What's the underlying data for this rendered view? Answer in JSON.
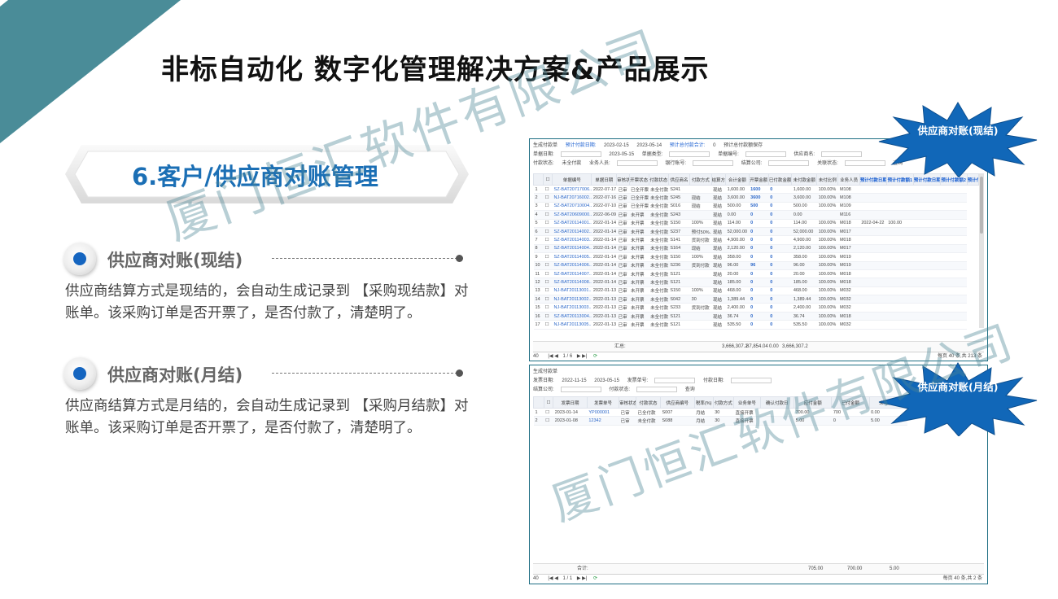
{
  "title": "非标自动化 数字化管理解决方案&产品展示",
  "section": "6.客户/供应商对账管理",
  "bullets": [
    {
      "heading": "供应商对账(现结)",
      "text": "供应商结算方式是现结的，会自动生成记录到 【采购现结款】对账单。该采购订单是否开票了，是否付款了，清楚明了。"
    },
    {
      "heading": "供应商对账(月结)",
      "text": "供应商结算方式是月结的，会自动生成记录到 【采购月结款】对账单。该采购订单是否开票了，是否付款了，清楚明了。"
    }
  ],
  "watermark": "厦门恒汇软件有限公司",
  "colors": {
    "teal": "#4a8c98",
    "title_blue": "#1b6fb5",
    "burst_blue": "#1167b8"
  },
  "bursts": {
    "top": "供应商对账(现结)",
    "bottom": "供应商对账(月结)"
  },
  "cash_panel": {
    "filters": {
      "btn_generate": "生成付款单",
      "plan_date_label": "预计付款日期:",
      "plan_date_from": "2023-02-15",
      "plan_date_to": "2023-05-14",
      "total_label": "预计总付款合计:",
      "total_value": "0",
      "save_plan": "预计总付款额保存",
      "order_date_label": "单据日期:",
      "order_date_to": "2023-05-15",
      "order_type_label": "单据类型:",
      "order_no_label": "单据编号:",
      "supplier_label": "供应商名:",
      "pay_status_label": "付款状态:",
      "pay_status_value": "未全付款",
      "salesman_label": "业务人员:",
      "bank_label": "银行账号:",
      "company_label": "结算公司:",
      "related_label": "关联状态:",
      "search": "查询"
    },
    "columns": [
      "单据编号",
      "单据日期",
      "审核状态",
      "开票状态",
      "付款状态",
      "供应商名",
      "付款方式",
      "结算方式",
      "合计金额",
      "开票金额",
      "已付款金额",
      "未付款金额",
      "未付比例",
      "业务人员",
      "预计付款日期1",
      "预计付款额1",
      "预计付款日期2",
      "预计付款额2",
      "预计付款日期"
    ],
    "rows": [
      [
        "1",
        "SZ-BAT20717006...",
        "2022-07-17",
        "已审",
        "已全开票",
        "未全付款",
        "S241",
        "",
        "现结",
        "1,600.00",
        "1600",
        "0",
        "1,600.00",
        "100.00%",
        "M108",
        "",
        "",
        "",
        ""
      ],
      [
        "2",
        "NJ-BAT20716002...",
        "2022-07-16",
        "已审",
        "已全开票",
        "未全付款",
        "S245",
        "现结",
        "现结",
        "3,600.00",
        "3600",
        "0",
        "3,600.00",
        "100.00%",
        "M108",
        "",
        "",
        "",
        ""
      ],
      [
        "3",
        "SZ-BAT20710004...",
        "2022-07-10",
        "已审",
        "已全开票",
        "未全付款",
        "S016",
        "现结",
        "现结",
        "500.00",
        "500",
        "0",
        "500.00",
        "100.00%",
        "M109",
        "",
        "",
        "",
        ""
      ],
      [
        "4",
        "SZ-BAT20609000...",
        "2022-06-09",
        "已审",
        "未开票",
        "未全付款",
        "S243",
        "",
        "现结",
        "0.00",
        "0",
        "0",
        "0.00",
        "",
        "M116",
        "",
        "",
        "",
        ""
      ],
      [
        "5",
        "SZ-BAT20114001...",
        "2022-01-14",
        "已审",
        "未开票",
        "未全付款",
        "S150",
        "100%",
        "现结",
        "114.00",
        "0",
        "0",
        "114.00",
        "100.00%",
        "M018",
        "2022-04-22",
        "100.00",
        "",
        ""
      ],
      [
        "6",
        "SZ-BAT20114002...",
        "2022-01-14",
        "已审",
        "未开票",
        "未全付款",
        "S237",
        "预付50%...",
        "现结",
        "52,000.00",
        "0",
        "0",
        "52,000.00",
        "100.00%",
        "M017",
        "",
        "",
        "",
        ""
      ],
      [
        "7",
        "SZ-BAT20114003...",
        "2022-01-14",
        "已审",
        "未开票",
        "未全付款",
        "S141",
        "货到付款",
        "现结",
        "4,900.00",
        "0",
        "0",
        "4,900.00",
        "100.00%",
        "M018",
        "",
        "",
        "",
        ""
      ],
      [
        "8",
        "SZ-BAT20114004...",
        "2022-01-14",
        "已审",
        "未开票",
        "未全付款",
        "S164",
        "现结",
        "现结",
        "2,120.00",
        "0",
        "0",
        "2,120.00",
        "100.00%",
        "M017",
        "",
        "",
        "",
        ""
      ],
      [
        "9",
        "SZ-BAT20114005...",
        "2022-01-14",
        "已审",
        "未开票",
        "未全付款",
        "S150",
        "100%",
        "现结",
        "358.00",
        "0",
        "0",
        "358.00",
        "100.00%",
        "M019",
        "",
        "",
        "",
        ""
      ],
      [
        "10",
        "SZ-BAT20114006...",
        "2022-01-14",
        "已审",
        "未开票",
        "未全付款",
        "S236",
        "货到付款",
        "现结",
        "96.00",
        "96",
        "0",
        "96.00",
        "100.00%",
        "M019",
        "",
        "",
        "",
        ""
      ],
      [
        "11",
        "SZ-BAT20114007...",
        "2022-01-14",
        "已审",
        "未开票",
        "未全付款",
        "S121",
        "",
        "现结",
        "20.00",
        "0",
        "0",
        "20.00",
        "100.00%",
        "M018",
        "",
        "",
        "",
        ""
      ],
      [
        "12",
        "SZ-BAT20114008...",
        "2022-01-14",
        "已审",
        "未开票",
        "未全付款",
        "S121",
        "",
        "现结",
        "185.00",
        "0",
        "0",
        "185.00",
        "100.00%",
        "M018",
        "",
        "",
        "",
        ""
      ],
      [
        "13",
        "NJ-BAT20113001...",
        "2022-01-13",
        "已审",
        "未开票",
        "未全付款",
        "S150",
        "100%",
        "现结",
        "468.00",
        "0",
        "0",
        "468.00",
        "100.00%",
        "M032",
        "",
        "",
        "",
        ""
      ],
      [
        "14",
        "NJ-BAT20113002...",
        "2022-01-13",
        "已审",
        "未开票",
        "未全付款",
        "S042",
        "30",
        "现结",
        "1,389.44",
        "0",
        "0",
        "1,389.44",
        "100.00%",
        "M032",
        "",
        "",
        "",
        ""
      ],
      [
        "15",
        "NJ-BAT20113003...",
        "2022-01-13",
        "已审",
        "未开票",
        "未全付款",
        "S233",
        "货到付款",
        "现结",
        "2,400.00",
        "0",
        "0",
        "2,400.00",
        "100.00%",
        "M032",
        "",
        "",
        "",
        ""
      ],
      [
        "16",
        "SZ-BAT20113004...",
        "2022-01-13",
        "已审",
        "未开票",
        "未全付款",
        "S121",
        "",
        "现结",
        "36.74",
        "0",
        "0",
        "36.74",
        "100.00%",
        "M018",
        "",
        "",
        "",
        ""
      ],
      [
        "17",
        "NJ-BAT20113005...",
        "2022-01-13",
        "已审",
        "未开票",
        "未全付款",
        "S121",
        "",
        "现结",
        "535.50",
        "0",
        "0",
        "535.50",
        "100.00%",
        "M032",
        "",
        "",
        "",
        ""
      ]
    ],
    "sum_label": "汇总:",
    "sum_total": "3,666,307.2",
    "sum_invoiced": "87,854.04",
    "sum_paid": "0.00",
    "sum_unpaid": "3,666,307.2",
    "page_size": "40",
    "page_current": "1",
    "page_total": "/ 6",
    "page_info": "每页 40 条,共 213 条"
  },
  "monthly_panel": {
    "filters": {
      "btn_generate": "生成付款单",
      "date_label": "发票日期:",
      "date_from": "2022-11-15",
      "date_to": "2023-05-15",
      "invoice_no_label": "发票单号:",
      "pay_date_label": "付款日期:",
      "company_label": "结算公司:",
      "pay_status_label": "付款状态:",
      "search": "查询"
    },
    "columns": [
      "发票日期",
      "发票单号",
      "审核状态",
      "付款状态",
      "供应商编号",
      "税率(%)",
      "付款方式",
      "业务单号",
      "确认付款日",
      "应付金额",
      "已付金额",
      "未付金额"
    ],
    "rows": [
      [
        "1",
        "2023-01-14",
        "YP000001",
        "已审",
        "已全付款",
        "S007",
        "月结",
        "30",
        "直接开票",
        "",
        "700.00",
        "700",
        "0.00"
      ],
      [
        "2",
        "2023-01-08",
        "12342",
        "已审",
        "未全付款",
        "S088",
        "月结",
        "30",
        "直接开票",
        "",
        "5.00",
        "0",
        "5.00"
      ]
    ],
    "sum_label": "合计:",
    "sum_due": "705.00",
    "sum_paid": "700.00",
    "sum_unpaid": "5.00",
    "page_size": "40",
    "page_current": "1",
    "page_total": "/ 1",
    "page_info": "每页 40 条,共 2 条"
  }
}
